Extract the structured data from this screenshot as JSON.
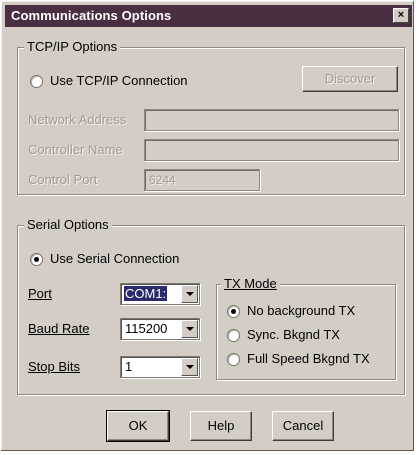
{
  "window": {
    "title": "Communications Options",
    "close_glyph": "×"
  },
  "tcpip": {
    "group_label": "TCP/IP Options",
    "use_label": "Use TCP/IP Connection",
    "use_selected": false,
    "discover_label": "Discover",
    "network_address_label": "Network Address",
    "network_address_value": "",
    "controller_name_label": "Controller Name",
    "controller_name_value": "",
    "control_port_label": "Control Port",
    "control_port_value": "6244"
  },
  "serial": {
    "group_label": "Serial Options",
    "use_label": "Use Serial Connection",
    "use_selected": true,
    "port_label": "Port",
    "port_value": "COM1:",
    "baud_label": "Baud Rate",
    "baud_value": "115200",
    "stop_label": "Stop Bits",
    "stop_value": "1",
    "txmode": {
      "group_label": "TX Mode",
      "options": [
        {
          "label": "No background TX",
          "selected": true
        },
        {
          "label": "Sync. Bkgnd TX",
          "selected": false
        },
        {
          "label": "Full Speed Bkgnd TX",
          "selected": false
        }
      ]
    }
  },
  "buttons": {
    "ok": "OK",
    "help": "Help",
    "cancel": "Cancel"
  },
  "colors": {
    "titlebar": "#4a2f43",
    "face": "#d4cdc6",
    "selection": "#2b2a6b"
  }
}
